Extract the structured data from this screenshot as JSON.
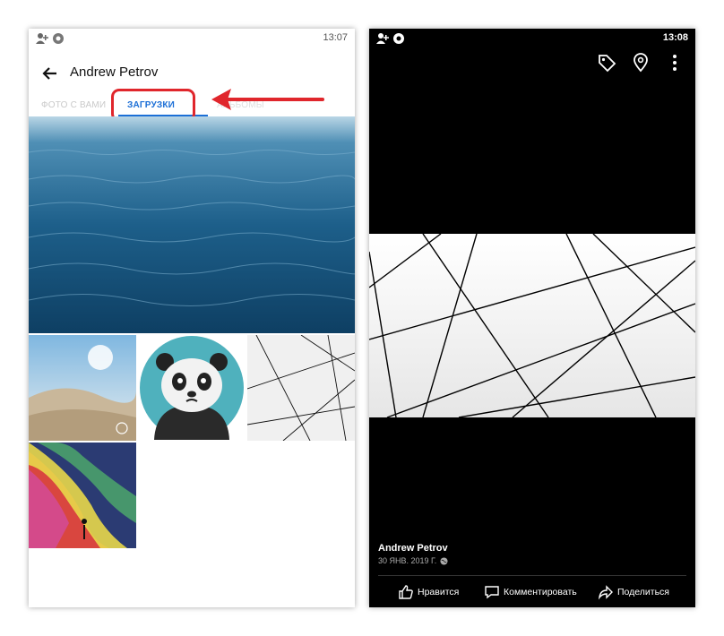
{
  "left_screen": {
    "status_bar": {
      "time": "13:07",
      "icons": [
        "add-user-icon",
        "chrome-icon"
      ]
    },
    "app_bar": {
      "title": "Andrew Petrov",
      "back_icon": "back-arrow-icon"
    },
    "tabs": [
      {
        "label": "ФОТО С ВАМИ",
        "active": false
      },
      {
        "label": "ЗАГРУЗКИ",
        "active": true
      },
      {
        "label": "АЛЬБОМЫ",
        "active": false
      }
    ],
    "highlight_color": "#e0262c",
    "accent_color": "#1c6fd6",
    "grid": {
      "photos": [
        "sea-waves-photo",
        "desert-dunes-photo",
        "panda-avatar-photo",
        "abstract-lines-photo",
        "colorful-painting-photo"
      ]
    }
  },
  "right_screen": {
    "status_bar": {
      "time": "13:08",
      "icons": [
        "add-user-icon",
        "chrome-icon"
      ]
    },
    "top_icons": [
      "tag-icon",
      "location-pin-icon",
      "more-vertical-icon"
    ],
    "photo": "abstract-lines-photo",
    "caption": {
      "name": "Andrew Petrov",
      "date": "30 ЯНВ. 2019 Г.",
      "privacy_icon": "globe-icon"
    },
    "actions": [
      {
        "label": "Нравится",
        "icon": "thumbs-up-icon"
      },
      {
        "label": "Комментировать",
        "icon": "comment-icon"
      },
      {
        "label": "Поделиться",
        "icon": "share-icon"
      }
    ]
  }
}
